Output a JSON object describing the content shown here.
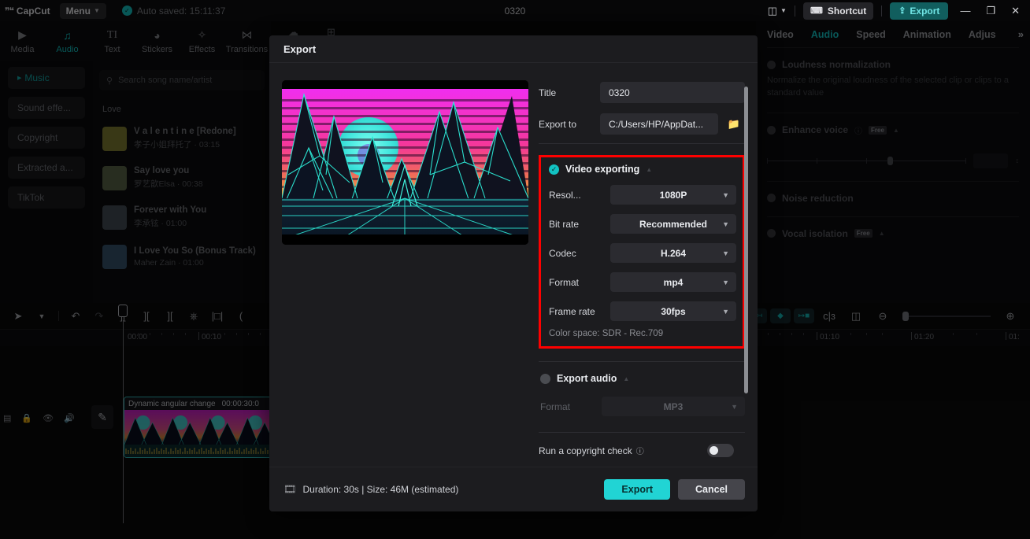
{
  "app": {
    "brand": "CapCut",
    "menu_label": "Menu",
    "autosave_text": "Auto saved: 15:11:37",
    "project_title": "0320"
  },
  "titlebar": {
    "layout_icon": "layout-icon",
    "shortcut_label": "Shortcut",
    "export_label": "Export",
    "minimize": "—",
    "maximize": "❐",
    "close": "✕"
  },
  "left_tabs": [
    {
      "label": "Media",
      "icon": "media-icon",
      "glyph": "▶",
      "active": false
    },
    {
      "label": "Audio",
      "icon": "audio-note-icon",
      "glyph": "♪",
      "active": true
    },
    {
      "label": "Text",
      "icon": "text-icon",
      "glyph": "TI",
      "active": false
    },
    {
      "label": "Stickers",
      "icon": "sticker-icon",
      "glyph": "◔",
      "active": false
    },
    {
      "label": "Effects",
      "icon": "effects-star-icon",
      "glyph": "✧",
      "active": false
    },
    {
      "label": "Transitions",
      "icon": "transitions-icon",
      "glyph": "⋈",
      "active": false
    }
  ],
  "left_nav": [
    {
      "label": "Music",
      "active": true
    },
    {
      "label": "Sound effe...",
      "active": false
    },
    {
      "label": "Copyright",
      "active": false
    },
    {
      "label": "Extracted a...",
      "active": false
    },
    {
      "label": "TikTok",
      "active": false
    }
  ],
  "search": {
    "placeholder": "Search song name/artist",
    "icon": "search-icon"
  },
  "song_group_label": "Love",
  "songs": [
    {
      "title": "V a l e n t i n e  [Redone]",
      "meta": "孝子小姐拜托了 · 03:15",
      "art": "#b9b545"
    },
    {
      "title": "Say love you",
      "meta": "罗艺歆Elsa · 00:38",
      "art": "#7d8f63"
    },
    {
      "title": "Forever with You",
      "meta": "李承铉 · 01:00",
      "art": "#5d6a74"
    },
    {
      "title": "I Love You So (Bonus Track)",
      "meta": "Maher Zain · 01:00",
      "art": "#4a7396"
    }
  ],
  "right_panel": {
    "tabs": [
      {
        "label": "Video",
        "active": false
      },
      {
        "label": "Audio",
        "active": true
      },
      {
        "label": "Speed",
        "active": false
      },
      {
        "label": "Animation",
        "active": false
      },
      {
        "label": "Adjus",
        "active": false
      }
    ],
    "more_icon": "chevron-double-right-icon",
    "sections": [
      {
        "title": "Loudness normalization",
        "desc": "Normalize the original loudness of the selected clip or clips to a standard value"
      },
      {
        "title": "Enhance voice",
        "badge": "Free"
      },
      {
        "title": "Noise reduction"
      },
      {
        "title": "Vocal isolation",
        "badge": "Free"
      }
    ]
  },
  "timeline": {
    "left_tools": [
      {
        "icon": "cursor-arrow-icon",
        "glyph": "➤"
      },
      {
        "icon": "chevron-down-icon",
        "glyph": "⌄"
      },
      {
        "icon": "undo-icon",
        "glyph": "↶"
      },
      {
        "icon": "redo-icon",
        "glyph": "↷"
      },
      {
        "icon": "split-icon",
        "glyph": "]["
      },
      {
        "icon": "trim-left-icon",
        "glyph": "]["
      },
      {
        "icon": "trim-right-icon",
        "glyph": "]["
      },
      {
        "icon": "delete-icon",
        "glyph": "Ὕ1"
      },
      {
        "icon": "freeze-frame-icon",
        "glyph": "|□|"
      },
      {
        "icon": "more-tools-icon",
        "glyph": "("
      }
    ],
    "right_tools": [
      {
        "icon": "mark-in-icon"
      },
      {
        "icon": "keyframe-icon"
      },
      {
        "icon": "mark-out-icon"
      },
      {
        "icon": "split-clip-icon"
      },
      {
        "icon": "fit-timeline-icon"
      },
      {
        "icon": "zoom-out-icon"
      },
      {
        "icon": "zoom-in-icon"
      }
    ],
    "ruler_left_labels": [
      "00:00",
      "00:10"
    ],
    "ruler_right_labels": [
      "01:10",
      "01:20",
      "01:"
    ],
    "track_ctrl_icons": [
      "track-thumb-icon",
      "lock-icon",
      "eye-icon",
      "mute-icon"
    ],
    "pencil_icon": "pencil-edit-icon",
    "clip": {
      "name": "Dynamic angular change",
      "duration": "00:00:30:0"
    }
  },
  "modal": {
    "title": "Export",
    "fields": [
      {
        "label": "Title",
        "value": "0320"
      },
      {
        "label": "Export to",
        "value": "C:/Users/HP/AppDat...",
        "has_folder_button": true
      }
    ],
    "folder_icon": "folder-icon",
    "video_group": {
      "title": "Video exporting",
      "checked": true,
      "collapse_icon": "chevron-up-icon",
      "rows": [
        {
          "label": "Resol...",
          "value": "1080P"
        },
        {
          "label": "Bit rate",
          "value": "Recommended"
        },
        {
          "label": "Codec",
          "value": "H.264"
        },
        {
          "label": "Format",
          "value": "mp4"
        },
        {
          "label": "Frame rate",
          "value": "30fps"
        }
      ],
      "color_space": "Color space: SDR - Rec.709",
      "highlight_color": "#fe0000"
    },
    "audio_group": {
      "title": "Export audio",
      "checked": false,
      "collapse_icon": "chevron-up-icon",
      "rows": [
        {
          "label": "Format",
          "value": "MP3"
        }
      ]
    },
    "copyright": {
      "label": "Run a copyright check",
      "info_icon": "info-icon",
      "enabled": false
    },
    "footer": {
      "info": "Duration: 30s | Size: 46M (estimated)",
      "film_icon": "film-icon",
      "export_label": "Export",
      "cancel_label": "Cancel"
    }
  },
  "colors": {
    "accent": "#12c2c2",
    "export_button": "#21d4d4",
    "highlight": "#fe0000"
  }
}
